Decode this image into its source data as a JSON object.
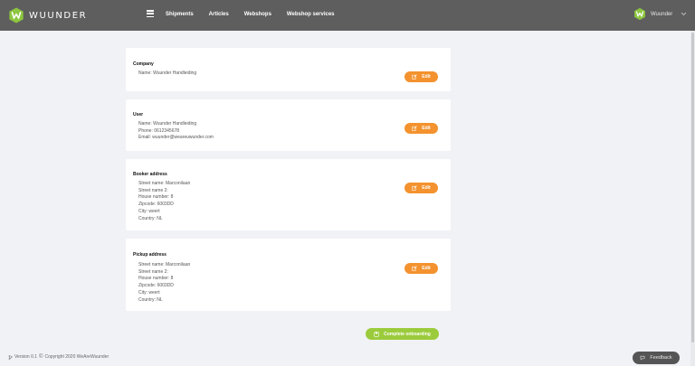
{
  "header": {
    "logo_text": "WUUNDER",
    "nav": [
      "Shipments",
      "Articles",
      "Webshops",
      "Webshop services"
    ],
    "user_name": "Wuunder",
    "colors": {
      "bar": "#5e5e5e",
      "brand_green": "#8dc63f"
    }
  },
  "company": {
    "title": "Company",
    "lines": [
      "Name: Wuunder Handleiding"
    ],
    "edit_label": "Edit"
  },
  "user": {
    "title": "User",
    "lines": [
      "Name: Wuunder Handleiding",
      "Phone: 0612345678",
      "Email: wuunder@weareuwunder.com"
    ],
    "edit_label": "Edit"
  },
  "booker": {
    "title": "Booker address",
    "lines": [
      "Street name: Marconilaan",
      "Street name 2:",
      "House number: 8",
      "Zipcode: 6003DD",
      "City: weert",
      "Country: NL"
    ],
    "edit_label": "Edit"
  },
  "pickup": {
    "title": "Pickup address",
    "lines": [
      "Street name: Marconilaan",
      "Street name 2:",
      "House number: 8",
      "Zipcode: 6003DD",
      "City: weert",
      "Country: NL"
    ],
    "edit_label": "Edit"
  },
  "actions": {
    "complete_label": "Complete onboarding",
    "complete_color": "#9bcb3c",
    "edit_color": "#f3922e"
  },
  "footer": {
    "version": "Version 0.1",
    "copyright": "Copyright 2020 WeAreWuunder"
  },
  "feedback": {
    "label": "Feedback"
  },
  "icons": {
    "edit": "edit-icon",
    "complete": "save-icon",
    "feedback": "chat-icon",
    "version": "branch-icon"
  }
}
